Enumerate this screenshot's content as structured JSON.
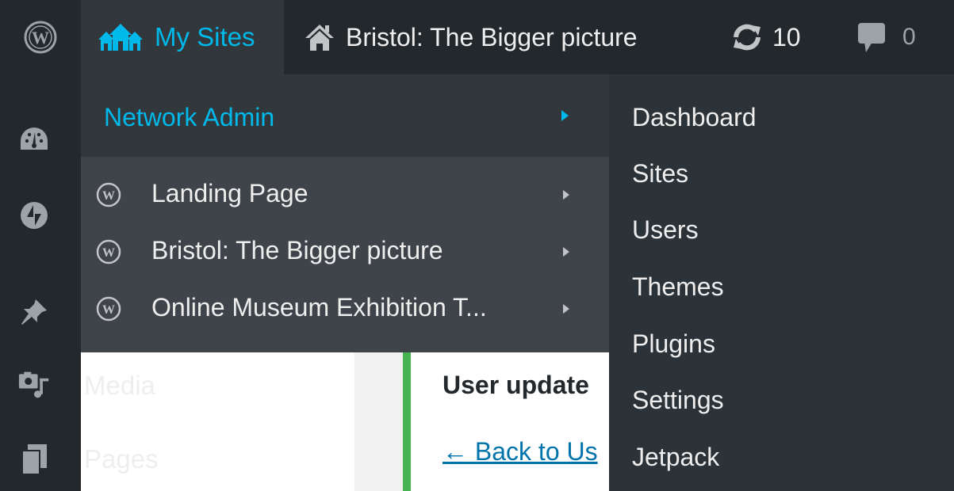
{
  "admin_bar": {
    "wp_logo_icon": "wordpress-logo-icon",
    "my_sites_label": "My Sites",
    "site_label": "Bristol: The Bigger picture",
    "updates_count": "10",
    "comments_count": "0"
  },
  "admin_menu": {
    "items": [
      {
        "icon": "dashboard-icon",
        "label": ""
      },
      {
        "icon": "jetpack-icon",
        "label": ""
      },
      {
        "icon": "pin-icon",
        "label": ""
      },
      {
        "icon": "media-icon",
        "label": "Media"
      },
      {
        "icon": "pages-icon",
        "label": "Pages"
      }
    ]
  },
  "content": {
    "notice_text": "User update",
    "back_link": "← Back to Us"
  },
  "my_sites_menu": {
    "network_admin": "Network Admin",
    "sites": [
      {
        "label": "Landing Page"
      },
      {
        "label": "Bristol: The Bigger picture"
      },
      {
        "label": "Online Museum Exhibition T..."
      }
    ]
  },
  "network_admin_submenu": {
    "items": [
      {
        "label": "Dashboard"
      },
      {
        "label": "Sites"
      },
      {
        "label": "Users"
      },
      {
        "label": "Themes"
      },
      {
        "label": "Plugins"
      },
      {
        "label": "Settings"
      },
      {
        "label": "Jetpack"
      }
    ]
  },
  "colors": {
    "admin_bar_bg": "#23282d",
    "accent_blue": "#00b9eb",
    "link_blue": "#0073aa",
    "notice_green": "#46b450"
  }
}
